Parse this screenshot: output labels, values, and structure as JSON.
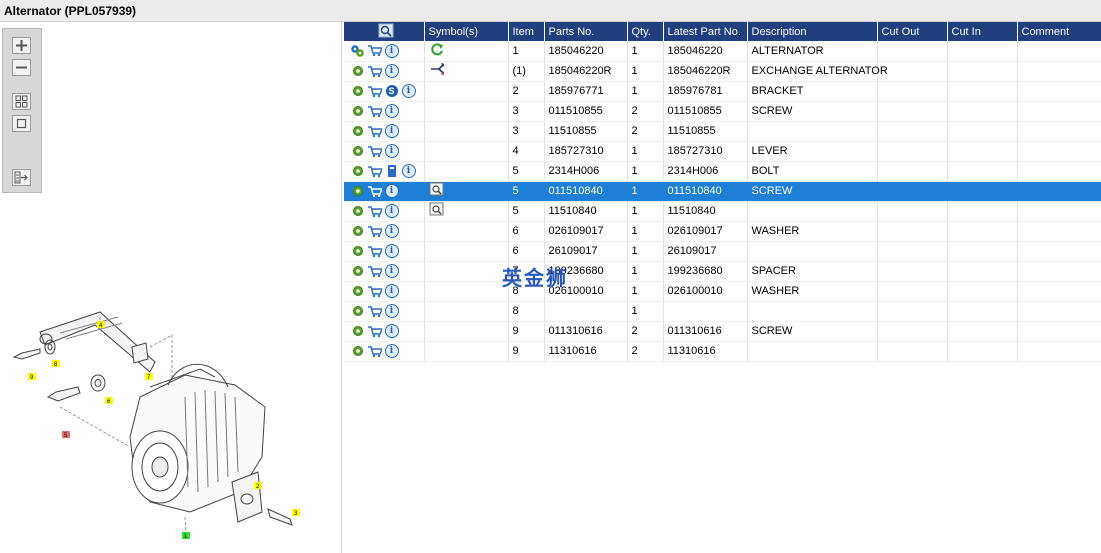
{
  "title": "Alternator (PPL057939)",
  "toolbar": {
    "zoom_in": "zoom-in",
    "zoom_out": "zoom-out",
    "fit_all": "fit-all",
    "fit_window": "fit-window",
    "export": "export"
  },
  "diagram": {
    "callouts": [
      "1",
      "2",
      "3",
      "4",
      "5",
      "6",
      "7",
      "8",
      "9"
    ]
  },
  "columns": [
    "",
    "Symbol(s)",
    "Item",
    "Parts No.",
    "Qty.",
    "Latest Part No.",
    "Description",
    "Cut Out",
    "Cut In",
    "Comment"
  ],
  "rows": [
    {
      "icons": [
        "gears-icon",
        "cart-icon",
        "info-icon"
      ],
      "symbol": "refresh-arrow-icon",
      "item": "1",
      "part_no": "185046220",
      "qty": "1",
      "latest": "185046220",
      "desc": "ALTERNATOR",
      "cut_out": "",
      "cut_in": "",
      "comment": ""
    },
    {
      "icons": [
        "gear-icon",
        "cart-icon",
        "info-icon"
      ],
      "symbol": "exchange-arrow-icon",
      "item": "(1)",
      "part_no": "185046220R",
      "qty": "1",
      "latest": "185046220R",
      "desc": "EXCHANGE ALTERNATOR",
      "cut_out": "",
      "cut_in": "",
      "comment": ""
    },
    {
      "icons": [
        "gear-icon",
        "cart-icon",
        "s-badge-icon",
        "info-icon"
      ],
      "symbol": "",
      "item": "2",
      "part_no": "185976771",
      "qty": "1",
      "latest": "185976781",
      "desc": "BRACKET",
      "cut_out": "",
      "cut_in": "",
      "comment": ""
    },
    {
      "icons": [
        "gear-icon",
        "cart-icon",
        "info-icon"
      ],
      "symbol": "",
      "item": "3",
      "part_no": "011510855",
      "qty": "2",
      "latest": "011510855",
      "desc": "SCREW",
      "cut_out": "",
      "cut_in": "",
      "comment": ""
    },
    {
      "icons": [
        "gear-icon",
        "cart-icon",
        "info-icon"
      ],
      "symbol": "",
      "item": "3",
      "part_no": "11510855",
      "qty": "2",
      "latest": "11510855",
      "desc": "",
      "cut_out": "",
      "cut_in": "",
      "comment": ""
    },
    {
      "icons": [
        "gear-icon",
        "cart-icon",
        "info-icon"
      ],
      "symbol": "",
      "item": "4",
      "part_no": "185727310",
      "qty": "1",
      "latest": "185727310",
      "desc": "LEVER",
      "cut_out": "",
      "cut_in": "",
      "comment": ""
    },
    {
      "icons": [
        "gear-icon",
        "cart-icon",
        "book-icon",
        "info-icon"
      ],
      "symbol": "",
      "item": "5",
      "part_no": "2314H006",
      "qty": "1",
      "latest": "2314H006",
      "desc": "BOLT",
      "cut_out": "",
      "cut_in": "",
      "comment": ""
    },
    {
      "icons": [
        "gear-icon",
        "cart-icon",
        "info-icon"
      ],
      "symbol": "magnifier-doc-icon",
      "item": "5",
      "part_no": "011510840",
      "qty": "1",
      "latest": "011510840",
      "desc": "SCREW",
      "cut_out": "",
      "cut_in": "",
      "comment": "",
      "selected": true
    },
    {
      "icons": [
        "gear-icon",
        "cart-icon",
        "info-icon"
      ],
      "symbol": "magnifier-doc-icon",
      "item": "5",
      "part_no": "11510840",
      "qty": "1",
      "latest": "11510840",
      "desc": "",
      "cut_out": "",
      "cut_in": "",
      "comment": ""
    },
    {
      "icons": [
        "gear-icon",
        "cart-icon",
        "info-icon"
      ],
      "symbol": "",
      "item": "6",
      "part_no": "026109017",
      "qty": "1",
      "latest": "026109017",
      "desc": "WASHER",
      "cut_out": "",
      "cut_in": "",
      "comment": ""
    },
    {
      "icons": [
        "gear-icon",
        "cart-icon",
        "info-icon"
      ],
      "symbol": "",
      "item": "6",
      "part_no": "26109017",
      "qty": "1",
      "latest": "26109017",
      "desc": "",
      "cut_out": "",
      "cut_in": "",
      "comment": ""
    },
    {
      "icons": [
        "gear-icon",
        "cart-icon",
        "info-icon"
      ],
      "symbol": "",
      "item": "7",
      "part_no": "199236680",
      "qty": "1",
      "latest": "199236680",
      "desc": "SPACER",
      "cut_out": "",
      "cut_in": "",
      "comment": ""
    },
    {
      "icons": [
        "gear-icon",
        "cart-icon",
        "info-icon"
      ],
      "symbol": "",
      "item": "8",
      "part_no": "026100010",
      "qty": "1",
      "latest": "026100010",
      "desc": "WASHER",
      "cut_out": "",
      "cut_in": "",
      "comment": ""
    },
    {
      "icons": [
        "gear-icon",
        "cart-icon",
        "info-icon"
      ],
      "symbol": "",
      "item": "8",
      "part_no": "",
      "qty": "1",
      "latest": "",
      "desc": "",
      "cut_out": "",
      "cut_in": "",
      "comment": ""
    },
    {
      "icons": [
        "gear-icon",
        "cart-icon",
        "info-icon"
      ],
      "symbol": "",
      "item": "9",
      "part_no": "011310616",
      "qty": "2",
      "latest": "011310616",
      "desc": "SCREW",
      "cut_out": "",
      "cut_in": "",
      "comment": ""
    },
    {
      "icons": [
        "gear-icon",
        "cart-icon",
        "info-icon"
      ],
      "symbol": "",
      "item": "9",
      "part_no": "11310616",
      "qty": "2",
      "latest": "11310616",
      "desc": "",
      "cut_out": "",
      "cut_in": "",
      "comment": ""
    }
  ],
  "watermark": "英金狮",
  "colors": {
    "header_bg": "#1f3f7f",
    "selected_row": "#1e7fd6",
    "gear_green": "#5aa02c",
    "cart_blue": "#2a6fc0"
  }
}
